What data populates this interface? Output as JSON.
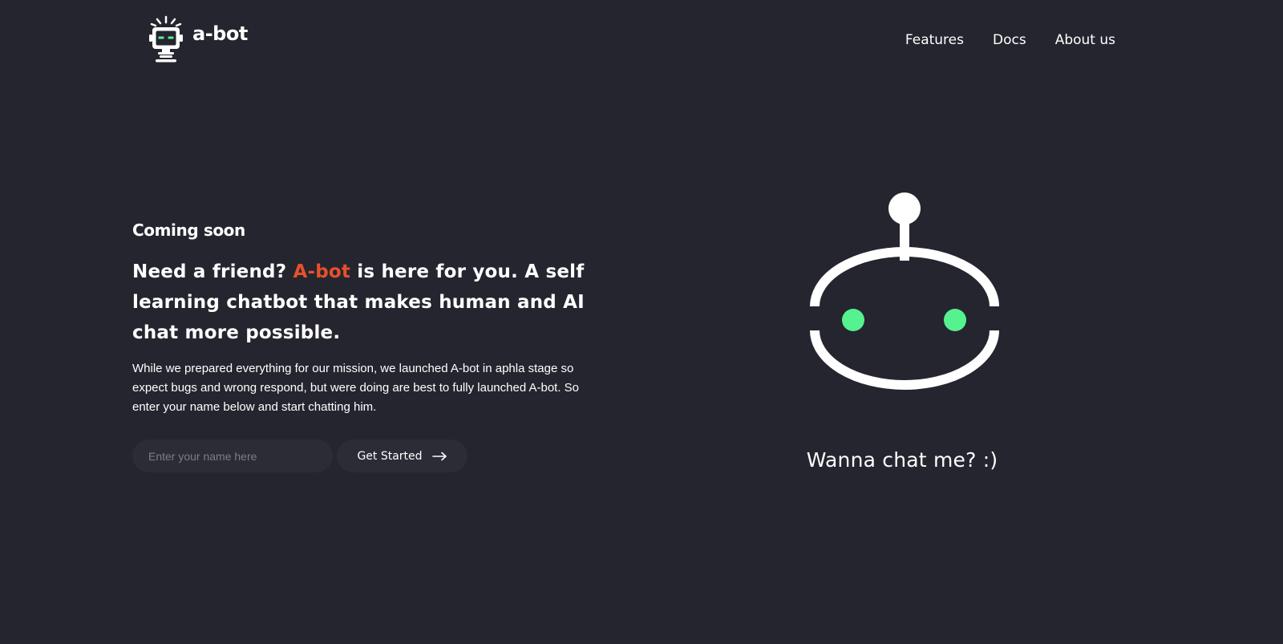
{
  "brand": {
    "name": "a-bot",
    "logo_icon": "robot-logo-icon"
  },
  "nav": {
    "links": [
      "Features",
      "Docs",
      "About us"
    ]
  },
  "hero": {
    "eyebrow": "Coming soon",
    "headline_before": "Need a friend? ",
    "headline_accent": "A-bot",
    "headline_after": " is here for you. A self learning chatbot that makes human and AI chat more possible.",
    "description": "While we prepared everything for our mission, we launched A-bot in aphla stage so expect bugs and wrong respond, but were doing are best to fully launched A-bot. So enter your name below and start chatting him.",
    "input_placeholder": "Enter your name here",
    "input_value": "",
    "button_label": "Get Started",
    "button_icon": "arrow-right-icon"
  },
  "robot": {
    "icon": "robot-face-icon",
    "caption": "Wanna chat me? :)"
  },
  "colors": {
    "background": "#25252f",
    "field": "#2c2c37",
    "accent": "#e5512c",
    "robot_eyes": "#55f28f",
    "text": "#ffffff"
  }
}
